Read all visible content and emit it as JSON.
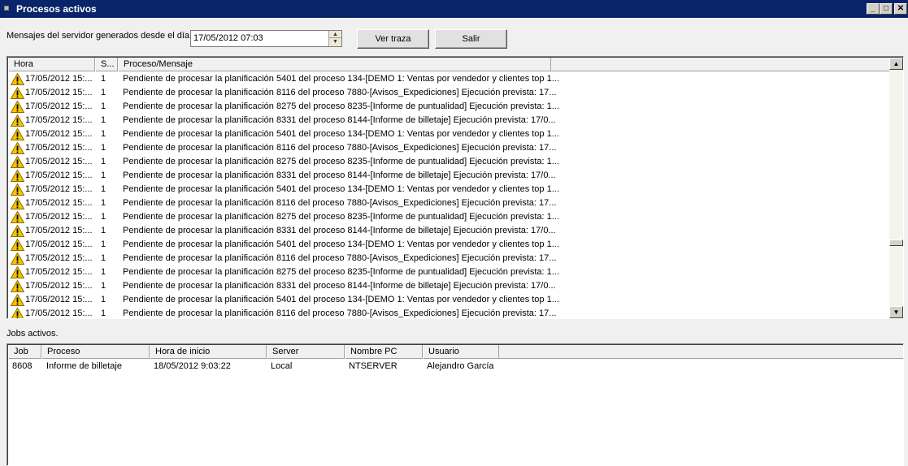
{
  "window": {
    "title": "Procesos activos"
  },
  "icons": {
    "minimize": "minimize-icon",
    "maximize": "maximize-icon",
    "close": "close-icon",
    "warning": "warning-triangle-icon"
  },
  "colors": {
    "titlebar": "#0a246a",
    "warning_fill": "#f5c400"
  },
  "filter": {
    "label": "Mensajes del servidor generados desde el día:",
    "date_value": "17/05/2012 07:03"
  },
  "buttons": {
    "trace": "Ver traza",
    "exit": "Salir"
  },
  "messages": {
    "columns": [
      "Hora",
      "S...",
      "Proceso/Mensaje"
    ],
    "rows": [
      {
        "hora": "17/05/2012 15:...",
        "s": "1",
        "msg": "Pendiente de procesar la planificación 5401 del proceso 134-[DEMO 1: Ventas por vendedor y clientes top 1..."
      },
      {
        "hora": "17/05/2012 15:...",
        "s": "1",
        "msg": "Pendiente de procesar la planificación 8116 del proceso 7880-[Avisos_Expediciones] Ejecución prevista: 17..."
      },
      {
        "hora": "17/05/2012 15:...",
        "s": "1",
        "msg": "Pendiente de procesar la planificación 8275 del proceso 8235-[Informe de puntualidad] Ejecución prevista: 1..."
      },
      {
        "hora": "17/05/2012 15:...",
        "s": "1",
        "msg": "Pendiente de procesar la planificación 8331 del proceso 8144-[Informe de billetaje] Ejecución prevista: 17/0..."
      },
      {
        "hora": "17/05/2012 15:...",
        "s": "1",
        "msg": "Pendiente de procesar la planificación 5401 del proceso 134-[DEMO 1: Ventas por vendedor y clientes top 1..."
      },
      {
        "hora": "17/05/2012 15:...",
        "s": "1",
        "msg": "Pendiente de procesar la planificación 8116 del proceso 7880-[Avisos_Expediciones] Ejecución prevista: 17..."
      },
      {
        "hora": "17/05/2012 15:...",
        "s": "1",
        "msg": "Pendiente de procesar la planificación 8275 del proceso 8235-[Informe de puntualidad] Ejecución prevista: 1..."
      },
      {
        "hora": "17/05/2012 15:...",
        "s": "1",
        "msg": "Pendiente de procesar la planificación 8331 del proceso 8144-[Informe de billetaje] Ejecución prevista: 17/0..."
      },
      {
        "hora": "17/05/2012 15:...",
        "s": "1",
        "msg": "Pendiente de procesar la planificación 5401 del proceso 134-[DEMO 1: Ventas por vendedor y clientes top 1..."
      },
      {
        "hora": "17/05/2012 15:...",
        "s": "1",
        "msg": "Pendiente de procesar la planificación 8116 del proceso 7880-[Avisos_Expediciones] Ejecución prevista: 17..."
      },
      {
        "hora": "17/05/2012 15:...",
        "s": "1",
        "msg": "Pendiente de procesar la planificación 8275 del proceso 8235-[Informe de puntualidad] Ejecución prevista: 1..."
      },
      {
        "hora": "17/05/2012 15:...",
        "s": "1",
        "msg": "Pendiente de procesar la planificación 8331 del proceso 8144-[Informe de billetaje] Ejecución prevista: 17/0..."
      },
      {
        "hora": "17/05/2012 15:...",
        "s": "1",
        "msg": "Pendiente de procesar la planificación 5401 del proceso 134-[DEMO 1: Ventas por vendedor y clientes top 1..."
      },
      {
        "hora": "17/05/2012 15:...",
        "s": "1",
        "msg": "Pendiente de procesar la planificación 8116 del proceso 7880-[Avisos_Expediciones] Ejecución prevista: 17..."
      },
      {
        "hora": "17/05/2012 15:...",
        "s": "1",
        "msg": "Pendiente de procesar la planificación 8275 del proceso 8235-[Informe de puntualidad] Ejecución prevista: 1..."
      },
      {
        "hora": "17/05/2012 15:...",
        "s": "1",
        "msg": "Pendiente de procesar la planificación 8331 del proceso 8144-[Informe de billetaje] Ejecución prevista: 17/0..."
      },
      {
        "hora": "17/05/2012 15:...",
        "s": "1",
        "msg": "Pendiente de procesar la planificación 5401 del proceso 134-[DEMO 1: Ventas por vendedor y clientes top 1..."
      },
      {
        "hora": "17/05/2012 15:...",
        "s": "1",
        "msg": "Pendiente de procesar la planificación 8116 del proceso 7880-[Avisos_Expediciones] Ejecución prevista: 17..."
      }
    ]
  },
  "jobs": {
    "label": "Jobs activos.",
    "columns": [
      "Job",
      "Proceso",
      "Hora de inicio",
      "Server",
      "Nombre PC",
      "Usuario"
    ],
    "rows": [
      {
        "job": "8608",
        "proceso": "Informe de billetaje",
        "inicio": "18/05/2012 9:03:22",
        "server": "Local",
        "pc": "NTSERVER",
        "usuario": "Alejandro García"
      }
    ]
  }
}
